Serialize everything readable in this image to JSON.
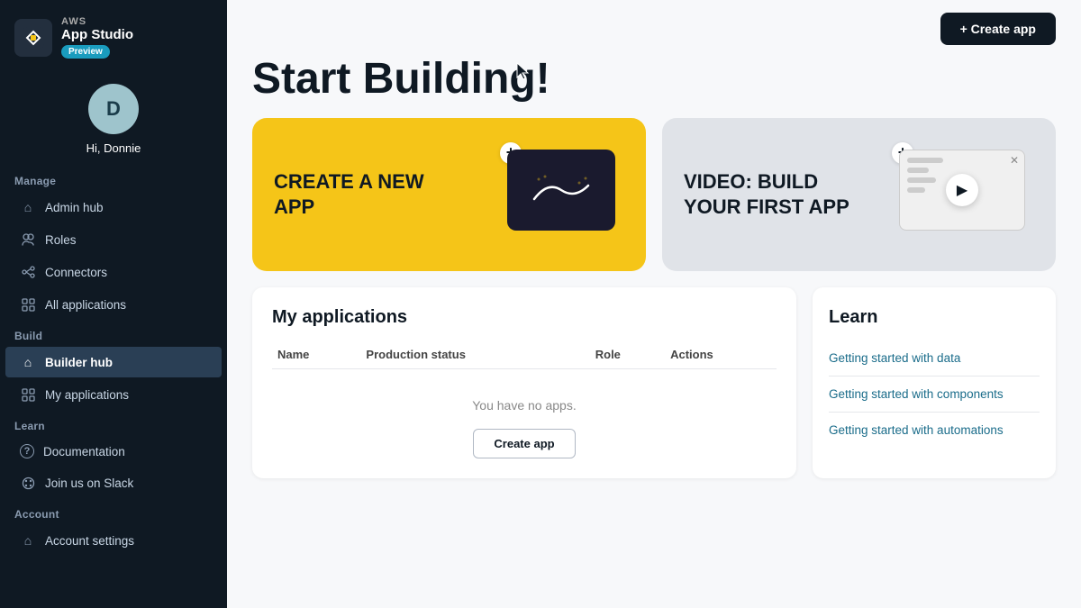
{
  "sidebar": {
    "logo": {
      "aws_label": "AWS",
      "app_studio_label": "App Studio",
      "preview_badge": "Preview"
    },
    "user": {
      "avatar_letter": "D",
      "greeting": "Hi, Donnie"
    },
    "sections": [
      {
        "label": "Manage",
        "items": [
          {
            "id": "admin-hub",
            "label": "Admin hub",
            "icon": "🏠"
          },
          {
            "id": "roles",
            "label": "Roles",
            "icon": "👤"
          },
          {
            "id": "connectors",
            "label": "Connectors",
            "icon": "🔗"
          },
          {
            "id": "all-applications",
            "label": "All applications",
            "icon": "◈"
          }
        ]
      },
      {
        "label": "Build",
        "items": [
          {
            "id": "builder-hub",
            "label": "Builder hub",
            "icon": "🏠",
            "active": true
          },
          {
            "id": "my-applications",
            "label": "My applications",
            "icon": "◈"
          }
        ]
      },
      {
        "label": "Learn",
        "items": [
          {
            "id": "documentation",
            "label": "Documentation",
            "icon": "?"
          },
          {
            "id": "join-slack",
            "label": "Join us on Slack",
            "icon": "⬡"
          }
        ]
      },
      {
        "label": "Account",
        "items": [
          {
            "id": "account-settings",
            "label": "Account settings",
            "icon": "🏠"
          }
        ]
      }
    ]
  },
  "header": {
    "create_app_label": "+ Create app"
  },
  "hero": {
    "title": "Start Building!"
  },
  "cards": [
    {
      "id": "create-new-app",
      "title": "CREATE A NEW APP",
      "bg": "#f5c518"
    },
    {
      "id": "video-card",
      "title": "VIDEO: BUILD YOUR FIRST APP",
      "bg": "#e0e3e8"
    }
  ],
  "my_applications": {
    "title": "My applications",
    "columns": [
      "Name",
      "Production status",
      "Role",
      "Actions"
    ],
    "empty_message": "You have no apps.",
    "create_button_label": "Create app"
  },
  "learn": {
    "title": "Learn",
    "items": [
      {
        "label": "Getting started with data"
      },
      {
        "label": "Getting started with components"
      },
      {
        "label": "Getting started with automations"
      }
    ]
  }
}
